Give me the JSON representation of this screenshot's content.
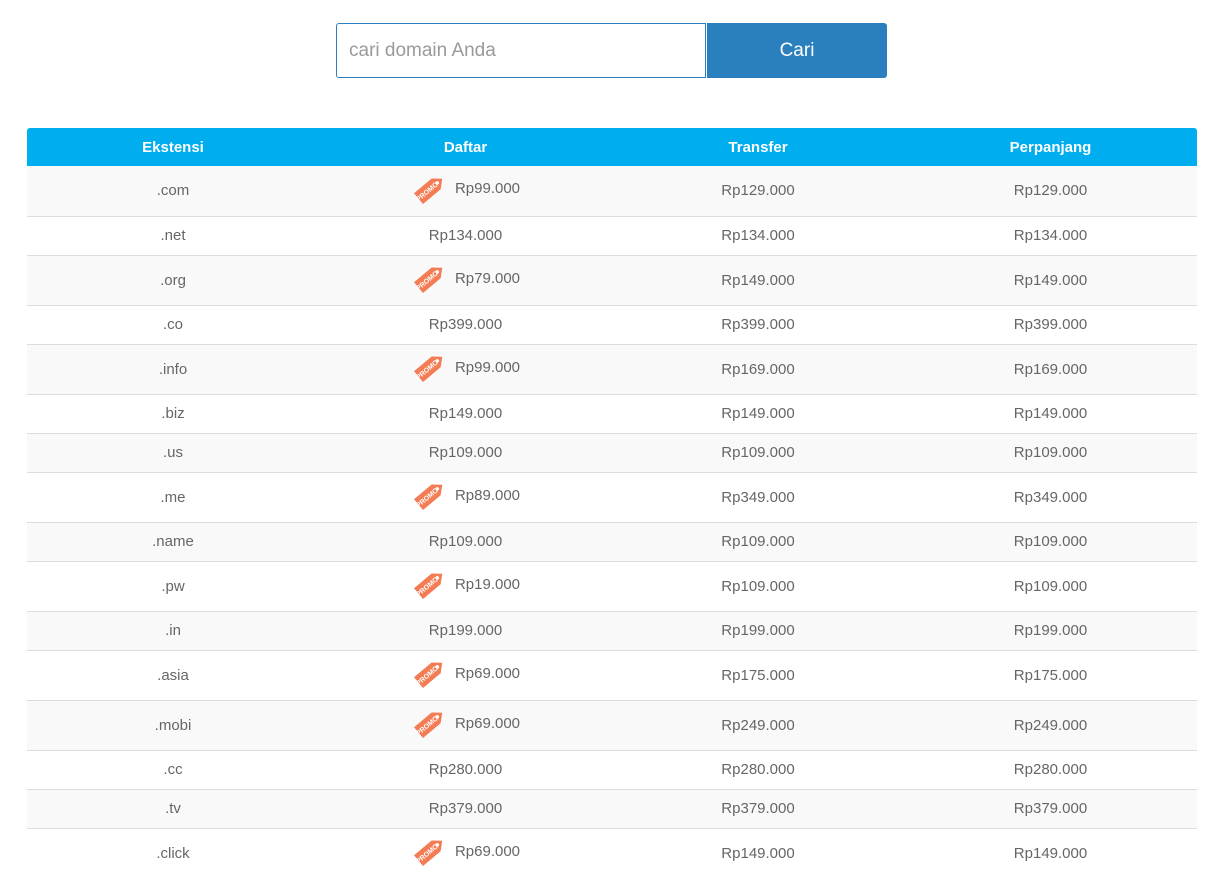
{
  "search": {
    "placeholder": "cari domain Anda",
    "value": "",
    "button_label": "Cari"
  },
  "table": {
    "headers": [
      "Ekstensi",
      "Daftar",
      "Transfer",
      "Perpanjang"
    ],
    "promo_badge_text": "PROMO",
    "promo_color": "#f47c54",
    "header_color": "#00adee",
    "rows": [
      {
        "ext": ".com",
        "promo": true,
        "daftar": "Rp99.000",
        "transfer": "Rp129.000",
        "perpanjang": "Rp129.000"
      },
      {
        "ext": ".net",
        "promo": false,
        "daftar": "Rp134.000",
        "transfer": "Rp134.000",
        "perpanjang": "Rp134.000"
      },
      {
        "ext": ".org",
        "promo": true,
        "daftar": "Rp79.000",
        "transfer": "Rp149.000",
        "perpanjang": "Rp149.000"
      },
      {
        "ext": ".co",
        "promo": false,
        "daftar": "Rp399.000",
        "transfer": "Rp399.000",
        "perpanjang": "Rp399.000"
      },
      {
        "ext": ".info",
        "promo": true,
        "daftar": "Rp99.000",
        "transfer": "Rp169.000",
        "perpanjang": "Rp169.000"
      },
      {
        "ext": ".biz",
        "promo": false,
        "daftar": "Rp149.000",
        "transfer": "Rp149.000",
        "perpanjang": "Rp149.000"
      },
      {
        "ext": ".us",
        "promo": false,
        "daftar": "Rp109.000",
        "transfer": "Rp109.000",
        "perpanjang": "Rp109.000"
      },
      {
        "ext": ".me",
        "promo": true,
        "daftar": "Rp89.000",
        "transfer": "Rp349.000",
        "perpanjang": "Rp349.000"
      },
      {
        "ext": ".name",
        "promo": false,
        "daftar": "Rp109.000",
        "transfer": "Rp109.000",
        "perpanjang": "Rp109.000"
      },
      {
        "ext": ".pw",
        "promo": true,
        "daftar": "Rp19.000",
        "transfer": "Rp109.000",
        "perpanjang": "Rp109.000"
      },
      {
        "ext": ".in",
        "promo": false,
        "daftar": "Rp199.000",
        "transfer": "Rp199.000",
        "perpanjang": "Rp199.000"
      },
      {
        "ext": ".asia",
        "promo": true,
        "daftar": "Rp69.000",
        "transfer": "Rp175.000",
        "perpanjang": "Rp175.000"
      },
      {
        "ext": ".mobi",
        "promo": true,
        "daftar": "Rp69.000",
        "transfer": "Rp249.000",
        "perpanjang": "Rp249.000"
      },
      {
        "ext": ".cc",
        "promo": false,
        "daftar": "Rp280.000",
        "transfer": "Rp280.000",
        "perpanjang": "Rp280.000"
      },
      {
        "ext": ".tv",
        "promo": false,
        "daftar": "Rp379.000",
        "transfer": "Rp379.000",
        "perpanjang": "Rp379.000"
      },
      {
        "ext": ".click",
        "promo": true,
        "daftar": "Rp69.000",
        "transfer": "Rp149.000",
        "perpanjang": "Rp149.000"
      }
    ]
  }
}
